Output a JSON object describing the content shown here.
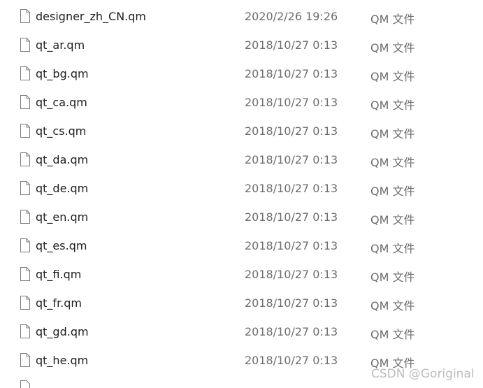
{
  "files": [
    {
      "name": "designer_zh_CN.qm",
      "modified": "2020/2/26 19:26",
      "type": "QM 文件",
      "icon": "file-icon"
    },
    {
      "name": "qt_ar.qm",
      "modified": "2018/10/27 0:13",
      "type": "QM 文件",
      "icon": "file-icon"
    },
    {
      "name": "qt_bg.qm",
      "modified": "2018/10/27 0:13",
      "type": "QM 文件",
      "icon": "file-icon"
    },
    {
      "name": "qt_ca.qm",
      "modified": "2018/10/27 0:13",
      "type": "QM 文件",
      "icon": "file-icon"
    },
    {
      "name": "qt_cs.qm",
      "modified": "2018/10/27 0:13",
      "type": "QM 文件",
      "icon": "file-icon"
    },
    {
      "name": "qt_da.qm",
      "modified": "2018/10/27 0:13",
      "type": "QM 文件",
      "icon": "file-icon"
    },
    {
      "name": "qt_de.qm",
      "modified": "2018/10/27 0:13",
      "type": "QM 文件",
      "icon": "file-icon"
    },
    {
      "name": "qt_en.qm",
      "modified": "2018/10/27 0:13",
      "type": "QM 文件",
      "icon": "file-icon"
    },
    {
      "name": "qt_es.qm",
      "modified": "2018/10/27 0:13",
      "type": "QM 文件",
      "icon": "file-icon"
    },
    {
      "name": "qt_fi.qm",
      "modified": "2018/10/27 0:13",
      "type": "QM 文件",
      "icon": "file-icon"
    },
    {
      "name": "qt_fr.qm",
      "modified": "2018/10/27 0:13",
      "type": "QM 文件",
      "icon": "file-icon"
    },
    {
      "name": "qt_gd.qm",
      "modified": "2018/10/27 0:13",
      "type": "QM 文件",
      "icon": "file-icon"
    },
    {
      "name": "qt_he.qm",
      "modified": "2018/10/27 0:13",
      "type": "QM 文件",
      "icon": "file-icon"
    }
  ],
  "watermark": "CSDN @Goriginal",
  "colors": {
    "name_text": "#1e1e1e",
    "secondary_text": "#6d6d6d",
    "icon_stroke": "#7a7a7a",
    "watermark": "#bdbdbd"
  }
}
